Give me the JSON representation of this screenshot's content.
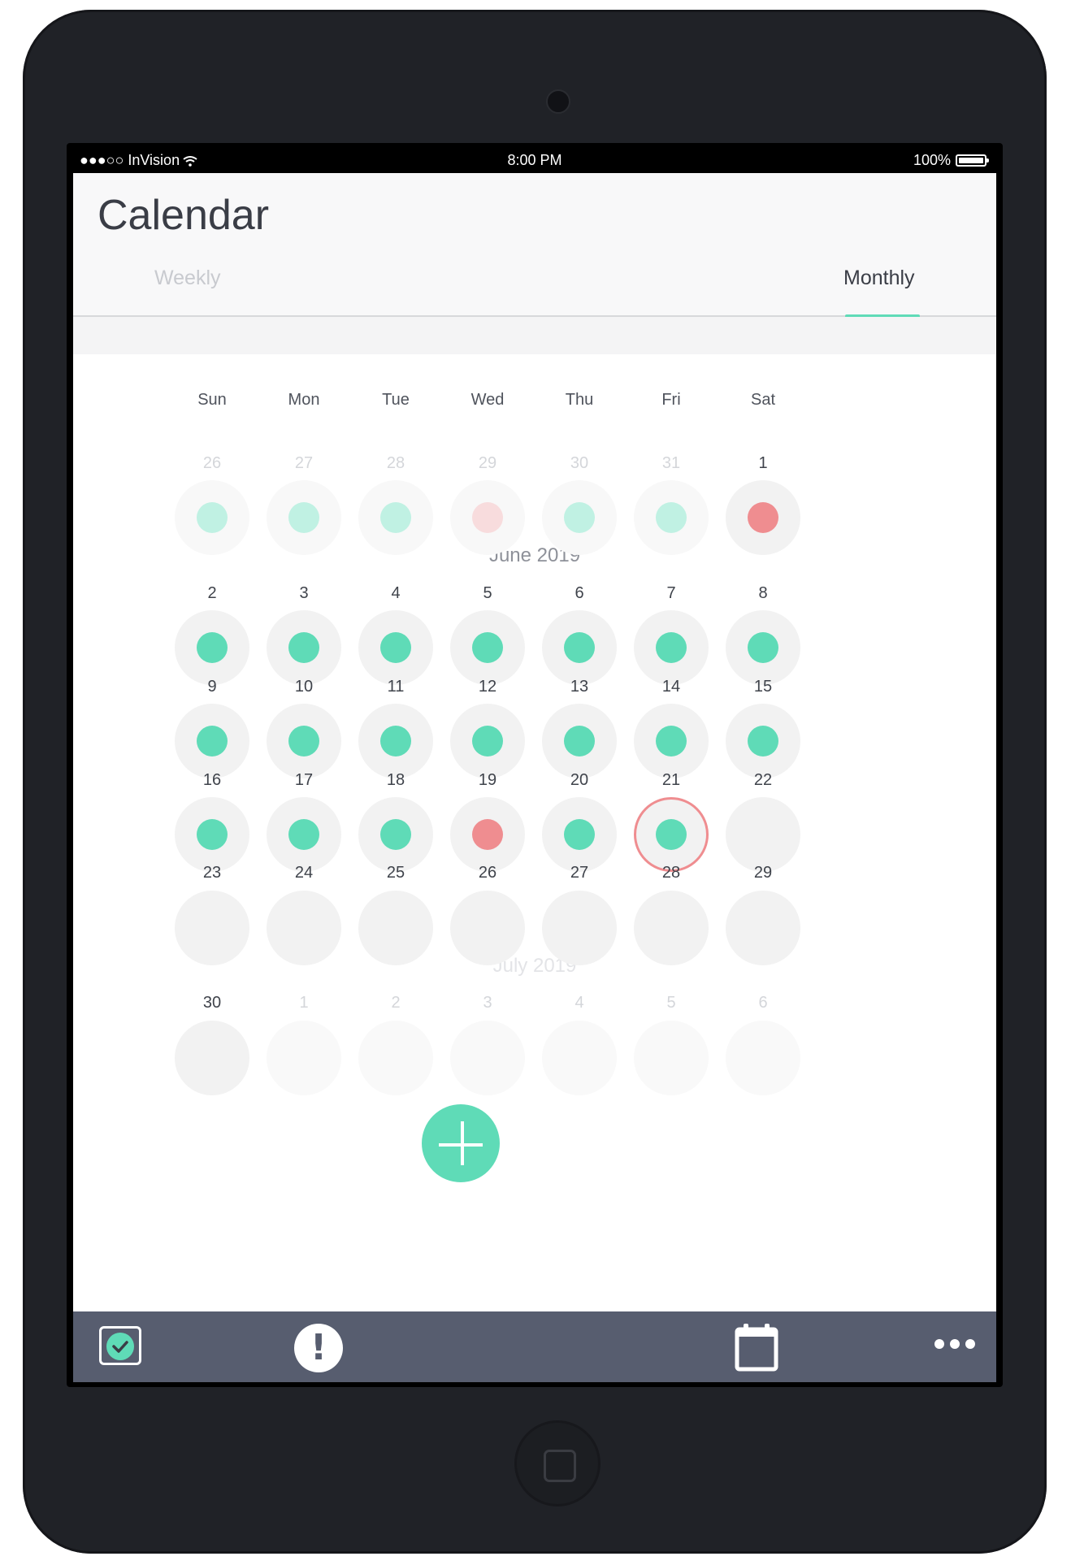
{
  "status_bar": {
    "carrier": "●●●○○ InVision",
    "time": "8:00 PM",
    "battery": "100%"
  },
  "header": {
    "title": "Calendar",
    "tabs": [
      {
        "label": "Weekly",
        "active": false
      },
      {
        "label": "Monthly",
        "active": true
      }
    ]
  },
  "colors": {
    "accent_green": "#5fdbb7",
    "accent_red": "#ef8d90",
    "light_green": "#c0f1e3",
    "light_red": "#f8dcdd",
    "tabbar": "#575d6f"
  },
  "weekdays": [
    "Sun",
    "Mon",
    "Tue",
    "Wed",
    "Thu",
    "Fri",
    "Sat"
  ],
  "month_labels": [
    {
      "label": "June 2019",
      "before_week": 1,
      "faded": false
    },
    {
      "label": "July 2019",
      "before_week": 5,
      "faded": true
    }
  ],
  "weeks": [
    [
      {
        "day": "26",
        "faded": true,
        "status": "green"
      },
      {
        "day": "27",
        "faded": true,
        "status": "green"
      },
      {
        "day": "28",
        "faded": true,
        "status": "green"
      },
      {
        "day": "29",
        "faded": true,
        "status": "red"
      },
      {
        "day": "30",
        "faded": true,
        "status": "green"
      },
      {
        "day": "31",
        "faded": true,
        "status": "green"
      },
      {
        "day": "1",
        "faded": false,
        "status": "red"
      }
    ],
    [
      {
        "day": "2",
        "faded": false,
        "status": "green"
      },
      {
        "day": "3",
        "faded": false,
        "status": "green"
      },
      {
        "day": "4",
        "faded": false,
        "status": "green"
      },
      {
        "day": "5",
        "faded": false,
        "status": "green"
      },
      {
        "day": "6",
        "faded": false,
        "status": "green"
      },
      {
        "day": "7",
        "faded": false,
        "status": "green"
      },
      {
        "day": "8",
        "faded": false,
        "status": "green"
      }
    ],
    [
      {
        "day": "9",
        "faded": false,
        "status": "green"
      },
      {
        "day": "10",
        "faded": false,
        "status": "green"
      },
      {
        "day": "11",
        "faded": false,
        "status": "green"
      },
      {
        "day": "12",
        "faded": false,
        "status": "green"
      },
      {
        "day": "13",
        "faded": false,
        "status": "green"
      },
      {
        "day": "14",
        "faded": false,
        "status": "green"
      },
      {
        "day": "15",
        "faded": false,
        "status": "green"
      }
    ],
    [
      {
        "day": "16",
        "faded": false,
        "status": "green"
      },
      {
        "day": "17",
        "faded": false,
        "status": "green"
      },
      {
        "day": "18",
        "faded": false,
        "status": "green"
      },
      {
        "day": "19",
        "faded": false,
        "status": "red"
      },
      {
        "day": "20",
        "faded": false,
        "status": "green"
      },
      {
        "day": "21",
        "faded": false,
        "status": "green",
        "today": true
      },
      {
        "day": "22",
        "faded": false,
        "status": "none"
      }
    ],
    [
      {
        "day": "23",
        "faded": false,
        "status": "none"
      },
      {
        "day": "24",
        "faded": false,
        "status": "none"
      },
      {
        "day": "25",
        "faded": false,
        "status": "none"
      },
      {
        "day": "26",
        "faded": false,
        "status": "none"
      },
      {
        "day": "27",
        "faded": false,
        "status": "none"
      },
      {
        "day": "28",
        "faded": false,
        "status": "none"
      },
      {
        "day": "29",
        "faded": false,
        "status": "none"
      }
    ],
    [
      {
        "day": "30",
        "faded": false,
        "status": "none"
      },
      {
        "day": "1",
        "faded": true,
        "status": "none"
      },
      {
        "day": "2",
        "faded": true,
        "status": "none"
      },
      {
        "day": "3",
        "faded": true,
        "status": "none"
      },
      {
        "day": "4",
        "faded": true,
        "status": "none"
      },
      {
        "day": "5",
        "faded": true,
        "status": "none"
      },
      {
        "day": "6",
        "faded": true,
        "status": "none"
      }
    ]
  ],
  "tab_bar": {
    "items": [
      {
        "icon": "checkbox-icon"
      },
      {
        "icon": "alert-icon"
      },
      {
        "icon": "add-icon"
      },
      {
        "icon": "calendar-icon"
      },
      {
        "icon": "more-icon"
      }
    ]
  }
}
